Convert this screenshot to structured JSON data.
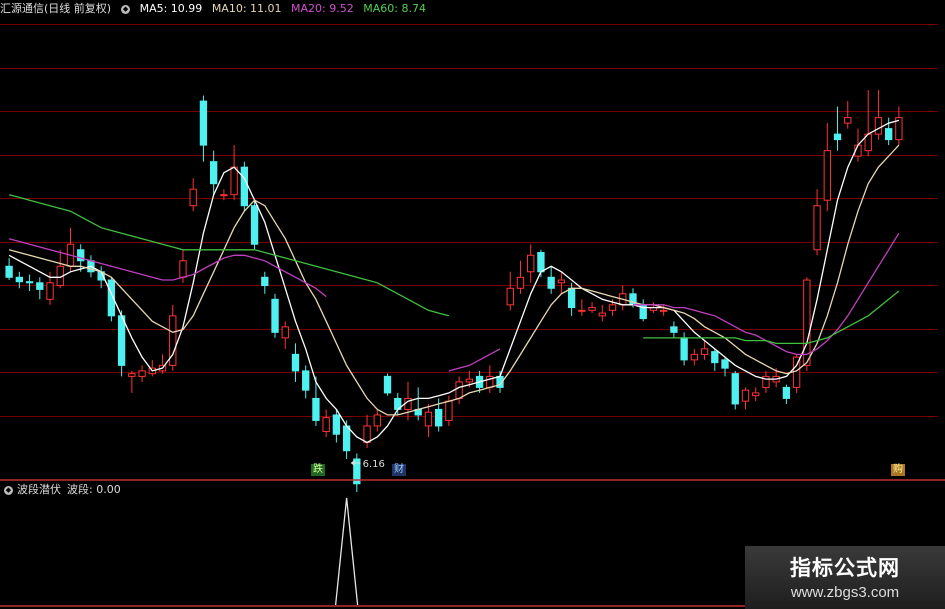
{
  "header": {
    "stock_name": "汇源通信(日线 前复权)",
    "ma5": "MA5: 10.99",
    "ma10": "MA10: 11.01",
    "ma20": "MA20: 9.52",
    "ma60": "MA60: 8.74"
  },
  "sub_header": {
    "indicator": "波段潜伏",
    "value": "波段: 0.00"
  },
  "markers": {
    "low_label": "6.16",
    "marker_die": "跌",
    "marker_cai": "财",
    "marker_gou": "购"
  },
  "watermark": {
    "line1": "指标公式网",
    "line2": "www.zbgs3.com"
  },
  "colors": {
    "up": "#ff3333",
    "down": "#4ff0f0",
    "ma5": "#ffffff",
    "ma10": "#e8d8b0",
    "ma20": "#c040c0",
    "ma60": "#40c040",
    "grid": "#7a0000",
    "divider": "#c03030"
  },
  "chart_data": [
    {
      "type": "candlestick",
      "ylim": [
        5.5,
        13.6
      ],
      "grid": true,
      "candles": [
        [
          9.2,
          9.0,
          9.35,
          8.95
        ],
        [
          9.0,
          8.92,
          9.1,
          8.8
        ],
        [
          8.92,
          8.9,
          9.05,
          8.75
        ],
        [
          8.9,
          8.78,
          9.0,
          8.6
        ],
        [
          8.6,
          8.9,
          9.1,
          8.5
        ],
        [
          8.85,
          9.2,
          9.5,
          8.8
        ],
        [
          9.2,
          9.6,
          9.9,
          9.1
        ],
        [
          9.5,
          9.3,
          9.6,
          9.1
        ],
        [
          9.3,
          9.1,
          9.4,
          9.0
        ],
        [
          9.1,
          8.95,
          9.2,
          8.8
        ],
        [
          8.95,
          8.3,
          9.0,
          8.2
        ],
        [
          8.3,
          7.4,
          8.4,
          7.2
        ],
        [
          7.2,
          7.25,
          7.3,
          6.9
        ],
        [
          7.2,
          7.3,
          7.4,
          7.1
        ],
        [
          7.25,
          7.35,
          7.5,
          7.2
        ],
        [
          7.3,
          7.4,
          7.6,
          7.25
        ],
        [
          7.4,
          8.3,
          8.5,
          7.3
        ],
        [
          9.0,
          9.3,
          9.5,
          8.9
        ],
        [
          10.3,
          10.6,
          10.8,
          10.2
        ],
        [
          12.2,
          11.4,
          12.3,
          11.1
        ],
        [
          11.1,
          10.7,
          11.3,
          10.5
        ],
        [
          10.5,
          10.5,
          10.6,
          10.4
        ],
        [
          10.5,
          11.0,
          11.4,
          10.4
        ],
        [
          11.0,
          10.3,
          11.1,
          10.2
        ],
        [
          10.3,
          9.6,
          10.4,
          9.5
        ],
        [
          9.0,
          8.85,
          9.1,
          8.7
        ],
        [
          8.6,
          8.0,
          8.7,
          7.9
        ],
        [
          7.9,
          8.1,
          8.2,
          7.7
        ],
        [
          7.6,
          7.3,
          7.8,
          7.1
        ],
        [
          7.3,
          6.95,
          7.4,
          6.8
        ],
        [
          6.8,
          6.4,
          7.2,
          6.3
        ],
        [
          6.2,
          6.45,
          6.6,
          6.1
        ],
        [
          6.5,
          6.15,
          6.6,
          6.0
        ],
        [
          6.3,
          5.85,
          6.4,
          5.7
        ],
        [
          5.7,
          5.25,
          5.8,
          5.1
        ],
        [
          6.0,
          6.3,
          6.5,
          5.9
        ],
        [
          6.3,
          6.5,
          6.6,
          6.2
        ],
        [
          7.2,
          6.9,
          7.25,
          6.85
        ],
        [
          6.8,
          6.6,
          6.9,
          6.5
        ],
        [
          6.6,
          6.8,
          7.1,
          6.4
        ],
        [
          6.6,
          6.5,
          7.0,
          6.4
        ],
        [
          6.3,
          6.55,
          6.7,
          6.1
        ],
        [
          6.6,
          6.3,
          6.8,
          6.2
        ],
        [
          6.4,
          6.75,
          6.85,
          6.3
        ],
        [
          6.8,
          7.1,
          7.2,
          6.7
        ],
        [
          7.1,
          7.15,
          7.3,
          7.0
        ],
        [
          7.2,
          7.0,
          7.3,
          6.9
        ],
        [
          7.0,
          7.2,
          7.4,
          6.9
        ],
        [
          7.2,
          7.0,
          7.3,
          6.9
        ],
        [
          8.5,
          8.8,
          9.1,
          8.4
        ],
        [
          8.8,
          9.0,
          9.3,
          8.7
        ],
        [
          9.1,
          9.4,
          9.6,
          8.9
        ],
        [
          9.45,
          9.1,
          9.5,
          9.0
        ],
        [
          9.0,
          8.8,
          9.2,
          8.7
        ],
        [
          8.9,
          8.95,
          9.1,
          8.7
        ],
        [
          8.8,
          8.45,
          8.9,
          8.3
        ],
        [
          8.4,
          8.4,
          8.6,
          8.3
        ],
        [
          8.4,
          8.45,
          8.55,
          8.35
        ],
        [
          8.3,
          8.35,
          8.5,
          8.2
        ],
        [
          8.4,
          8.5,
          8.6,
          8.3
        ],
        [
          8.5,
          8.7,
          8.85,
          8.4
        ],
        [
          8.7,
          8.5,
          8.8,
          8.45
        ],
        [
          8.5,
          8.25,
          8.6,
          8.2
        ],
        [
          8.4,
          8.45,
          8.55,
          8.35
        ],
        [
          8.4,
          8.4,
          8.5,
          8.3
        ],
        [
          8.1,
          8.0,
          8.2,
          7.9
        ],
        [
          7.9,
          7.5,
          8.0,
          7.4
        ],
        [
          7.5,
          7.6,
          7.7,
          7.4
        ],
        [
          7.6,
          7.7,
          7.85,
          7.5
        ],
        [
          7.65,
          7.45,
          7.7,
          7.3
        ],
        [
          7.5,
          7.35,
          7.55,
          7.2
        ],
        [
          7.25,
          6.7,
          7.3,
          6.6
        ],
        [
          6.75,
          6.95,
          7.0,
          6.6
        ],
        [
          6.85,
          6.9,
          7.0,
          6.75
        ],
        [
          7.0,
          7.2,
          7.3,
          6.9
        ],
        [
          7.1,
          7.2,
          7.35,
          7.0
        ],
        [
          7.0,
          6.8,
          7.05,
          6.7
        ],
        [
          7.0,
          7.55,
          7.6,
          6.9
        ],
        [
          7.4,
          8.95,
          9.0,
          7.3
        ],
        [
          9.5,
          10.3,
          10.6,
          9.4
        ],
        [
          10.4,
          11.3,
          11.8,
          10.2
        ],
        [
          11.6,
          11.5,
          12.1,
          11.3
        ],
        [
          11.8,
          11.9,
          12.2,
          11.7
        ],
        [
          11.2,
          11.4,
          11.7,
          11.1
        ],
        [
          11.3,
          11.6,
          12.4,
          11.2
        ],
        [
          11.6,
          11.9,
          12.4,
          11.5
        ],
        [
          11.7,
          11.5,
          11.9,
          11.4
        ],
        [
          11.5,
          11.9,
          12.1,
          11.4
        ]
      ],
      "ma_series": [
        {
          "name": "MA5",
          "values": [
            9.4,
            9.3,
            9.2,
            9.1,
            9.0,
            9.0,
            9.1,
            9.15,
            9.2,
            9.1,
            8.7,
            8.3,
            7.9,
            7.55,
            7.3,
            7.35,
            7.6,
            8.1,
            8.9,
            9.8,
            10.5,
            10.9,
            11.0,
            10.8,
            10.4,
            10.0,
            9.4,
            8.8,
            8.2,
            7.7,
            7.1,
            6.8,
            6.6,
            6.3,
            6.1,
            6.0,
            6.1,
            6.3,
            6.6,
            6.75,
            6.8,
            6.8,
            6.85,
            6.9,
            7.0,
            7.05,
            7.1,
            7.15,
            7.2,
            7.7,
            8.2,
            8.7,
            9.1,
            9.2,
            9.1,
            8.95,
            8.8,
            8.7,
            8.6,
            8.55,
            8.5,
            8.5,
            8.45,
            8.45,
            8.45,
            8.4,
            8.2,
            8.0,
            7.85,
            7.7,
            7.55,
            7.4,
            7.3,
            7.2,
            7.15,
            7.15,
            7.2,
            7.4,
            7.8,
            8.6,
            9.5,
            10.4,
            11.0,
            11.4,
            11.6,
            11.7,
            11.8,
            11.85
          ]
        },
        {
          "name": "MA10",
          "values": [
            9.5,
            9.45,
            9.4,
            9.35,
            9.3,
            9.25,
            9.2,
            9.2,
            9.15,
            9.1,
            9.0,
            8.8,
            8.6,
            8.4,
            8.2,
            8.1,
            8.0,
            8.05,
            8.3,
            8.7,
            9.1,
            9.5,
            9.9,
            10.2,
            10.4,
            10.3,
            10.0,
            9.7,
            9.3,
            8.9,
            8.6,
            8.2,
            7.8,
            7.4,
            7.1,
            6.8,
            6.6,
            6.5,
            6.5,
            6.55,
            6.6,
            6.65,
            6.7,
            6.75,
            6.8,
            6.9,
            6.95,
            7.0,
            7.05,
            7.3,
            7.6,
            7.9,
            8.2,
            8.5,
            8.7,
            8.8,
            8.8,
            8.75,
            8.7,
            8.65,
            8.6,
            8.55,
            8.5,
            8.5,
            8.45,
            8.4,
            8.35,
            8.25,
            8.1,
            8.0,
            7.9,
            7.75,
            7.6,
            7.5,
            7.4,
            7.3,
            7.25,
            7.3,
            7.45,
            7.8,
            8.3,
            8.9,
            9.6,
            10.2,
            10.7,
            11.0,
            11.2,
            11.4
          ]
        },
        {
          "name": "MA20",
          "values": [
            9.7,
            9.65,
            9.6,
            9.55,
            9.5,
            9.45,
            9.4,
            9.35,
            9.3,
            9.25,
            9.2,
            9.15,
            9.1,
            9.05,
            9.0,
            8.95,
            8.95,
            9.0,
            9.05,
            9.15,
            9.25,
            9.35,
            9.4,
            9.4,
            9.35,
            9.3,
            9.2,
            9.1,
            9.0,
            8.9,
            8.8,
            8.65,
            null,
            null,
            null,
            null,
            null,
            null,
            null,
            null,
            null,
            null,
            null,
            7.3,
            7.35,
            7.4,
            7.5,
            7.6,
            7.7,
            null,
            null,
            null,
            null,
            null,
            null,
            null,
            null,
            null,
            null,
            null,
            null,
            8.5,
            8.5,
            8.5,
            8.5,
            8.45,
            8.45,
            8.4,
            8.35,
            8.3,
            8.2,
            8.1,
            8.0,
            7.95,
            7.85,
            7.75,
            7.65,
            7.6,
            7.6,
            7.7,
            7.85,
            8.05,
            8.3,
            8.6,
            8.9,
            9.2,
            9.5,
            9.8
          ]
        },
        {
          "name": "MA60",
          "values": [
            10.5,
            10.45,
            10.4,
            10.35,
            10.3,
            10.25,
            10.2,
            10.1,
            10.0,
            9.9,
            9.85,
            9.8,
            9.75,
            9.7,
            9.65,
            9.6,
            9.55,
            9.5,
            9.5,
            9.5,
            9.5,
            9.5,
            9.5,
            9.5,
            9.5,
            9.45,
            9.4,
            9.35,
            9.3,
            9.25,
            9.2,
            9.15,
            9.1,
            9.05,
            9.0,
            8.95,
            8.9,
            8.8,
            8.7,
            8.6,
            8.5,
            8.4,
            8.35,
            8.3,
            null,
            null,
            null,
            null,
            null,
            null,
            null,
            null,
            null,
            null,
            null,
            null,
            null,
            null,
            null,
            null,
            null,
            null,
            7.9,
            7.9,
            7.9,
            7.9,
            7.9,
            7.9,
            7.9,
            7.9,
            7.9,
            7.9,
            7.85,
            7.85,
            7.85,
            7.8,
            7.8,
            7.8,
            7.8,
            7.85,
            7.9,
            8.0,
            8.1,
            8.2,
            8.3,
            8.45,
            8.6,
            8.75
          ]
        }
      ]
    },
    {
      "type": "line",
      "name": "波段",
      "spike_index": 33,
      "spike_value": 1,
      "ylim": [
        0,
        1
      ]
    }
  ]
}
